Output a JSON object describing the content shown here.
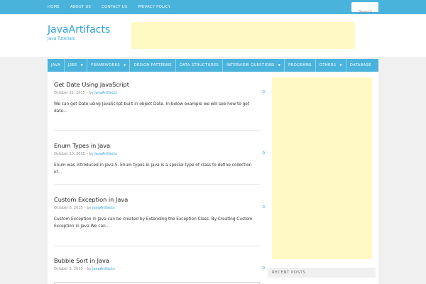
{
  "topnav": [
    "HOME",
    "ABOUT US",
    "CONTACT US",
    "PRIVACY POLICY"
  ],
  "search": {
    "placeholder": "Search"
  },
  "site": {
    "title": "JavaArtifacts",
    "description": "Java Tutorials"
  },
  "mainnav": [
    {
      "label": "JAVA",
      "dropdown": false
    },
    {
      "label": "J2EE",
      "dropdown": true
    },
    {
      "label": "FRAMEWORKS",
      "dropdown": true
    },
    {
      "label": "DESIGN PATTERNS",
      "dropdown": false
    },
    {
      "label": "DATA STRUCTURES",
      "dropdown": false
    },
    {
      "label": "INTERVIEW QUESTIONS",
      "dropdown": true
    },
    {
      "label": "PROGRAMS",
      "dropdown": false
    },
    {
      "label": "OTHERS",
      "dropdown": true
    },
    {
      "label": "DATABASE",
      "dropdown": false
    }
  ],
  "posts": [
    {
      "title": "Get Date Using JavaScript",
      "date": "October 11, 2015",
      "by_sep": " – by ",
      "author": "JavaArtifacts",
      "comments": "0",
      "excerpt": "We can get Date using JavaScript built in object Date. In below example we will see how to get date…"
    },
    {
      "title": "Enum Types in Java",
      "date": "October 10, 2015",
      "by_sep": " – by ",
      "author": "JavaArtifacts",
      "comments": "0",
      "excerpt": "Enum was introduced in java 5. Enum types in java is a special type of class to define collection of…"
    },
    {
      "title": "Custom Exception in Java",
      "date": "October 6, 2015",
      "by_sep": " – by ",
      "author": "JavaArtifacts",
      "comments": "0",
      "excerpt": "Custom Exception in Java can be created by Extending the Exception Class. By Creating Custom Exception in Java We can…"
    },
    {
      "title": "Bubble Sort in Java",
      "date": "October 5, 2015",
      "by_sep": " – by ",
      "author": "JavaArtifacts",
      "comments": "0",
      "excerpt": ""
    }
  ],
  "sidebar": {
    "recent_posts_heading": "RECENT POSTS"
  },
  "colors": {
    "accent": "#4ab3dc",
    "link": "#2aa3d6",
    "ad_background": "#fff9c4"
  }
}
